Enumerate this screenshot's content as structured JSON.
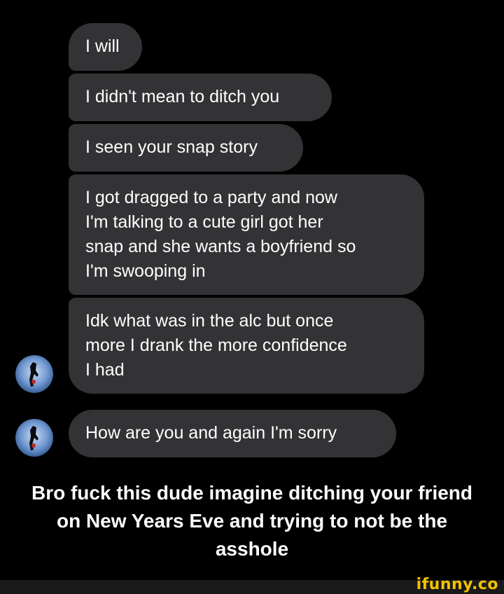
{
  "messages": [
    {
      "text": "I will"
    },
    {
      "text": "I didn't mean to ditch you"
    },
    {
      "text": "I seen your snap story"
    },
    {
      "text": "I got dragged to a party and now\nI'm talking to a cute girl got her\nsnap and she wants a boyfriend so\nI'm swooping in"
    },
    {
      "text": "Idk what was in the alc but once\nmore I drank the more confidence\nI had"
    },
    {
      "text": "How are you and again I'm sorry"
    }
  ],
  "caption": "Bro fuck this dude imagine ditching your friend\non New Years Eve and trying to not be the\nasshole",
  "watermark": "ifunny.co",
  "colors": {
    "background": "#000000",
    "bubble": "#333336",
    "text": "#ffffff",
    "watermark": "#f2c200"
  },
  "icons": {
    "avatar": "contact-avatar-icon"
  }
}
